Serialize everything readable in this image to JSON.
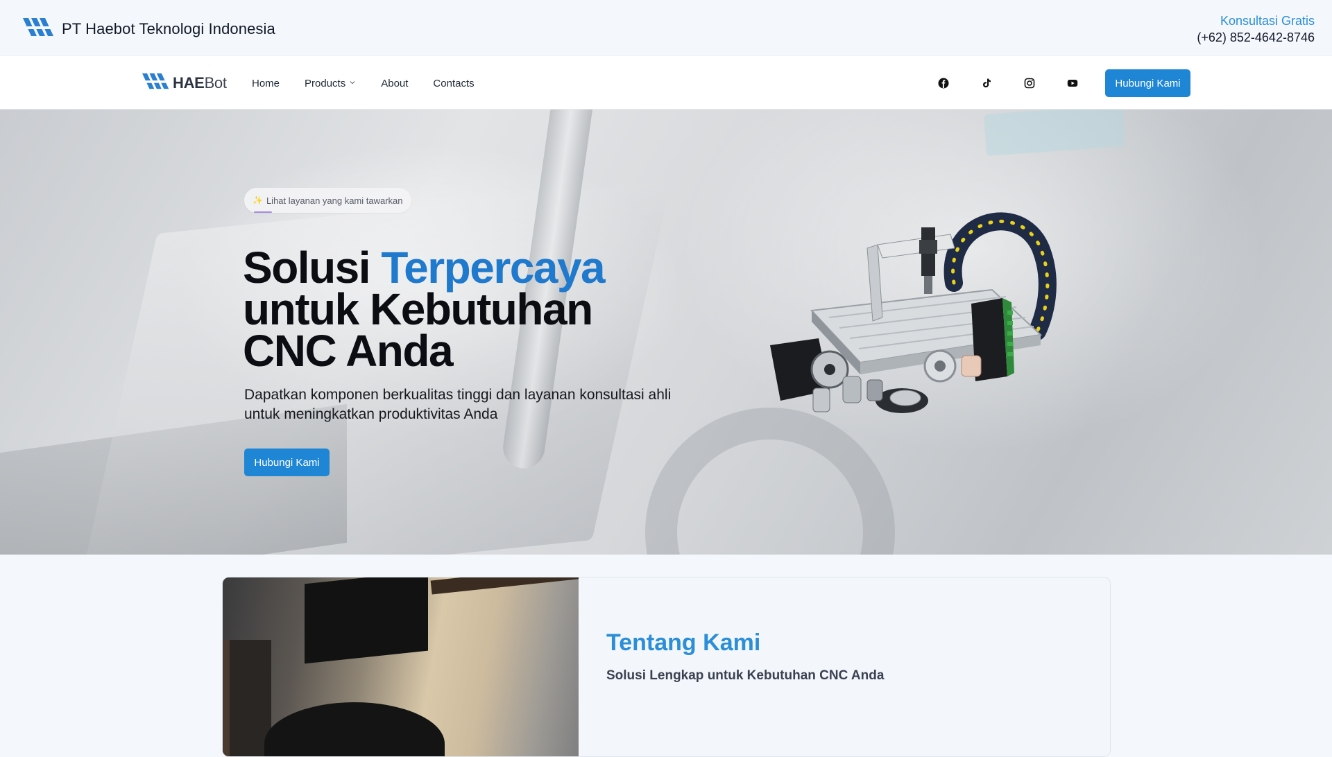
{
  "topbar": {
    "company_name": "PT Haebot Teknologi Indonesia",
    "consult_label": "Konsultasi Gratis",
    "phone": "(+62) 852-4642-8746"
  },
  "navbar": {
    "logo": {
      "bold": "HAE",
      "light": "Bot"
    },
    "menu": [
      {
        "label": "Home"
      },
      {
        "label": "Products",
        "icon": "chevron-down-icon"
      },
      {
        "label": "About"
      },
      {
        "label": "Contacts"
      }
    ],
    "socials": [
      {
        "name": "facebook-icon"
      },
      {
        "name": "tiktok-icon"
      },
      {
        "name": "instagram-icon"
      },
      {
        "name": "youtube-icon"
      }
    ],
    "cta_label": "Hubungi Kami"
  },
  "hero": {
    "pill_label": "Lihat layanan yang kami tawarkan",
    "pill_icon": "sparkle-icon",
    "title_part1": "Solusi ",
    "title_accent": "Terpercaya",
    "title_part2": "untuk Kebutuhan CNC Anda",
    "subtitle": "Dapatkan komponen berkualitas tinggi dan layanan konsultasi ahli untuk meningkatkan produktivitas Anda",
    "cta_label": "Hubungi Kami"
  },
  "about": {
    "heading": "Tentang Kami",
    "subheading": "Solusi Lengkap untuk Kebutuhan CNC Anda"
  },
  "colors": {
    "accent": "#1f86d6",
    "accent_text": "#2b8ed6",
    "title_accent": "#1f79cc"
  }
}
